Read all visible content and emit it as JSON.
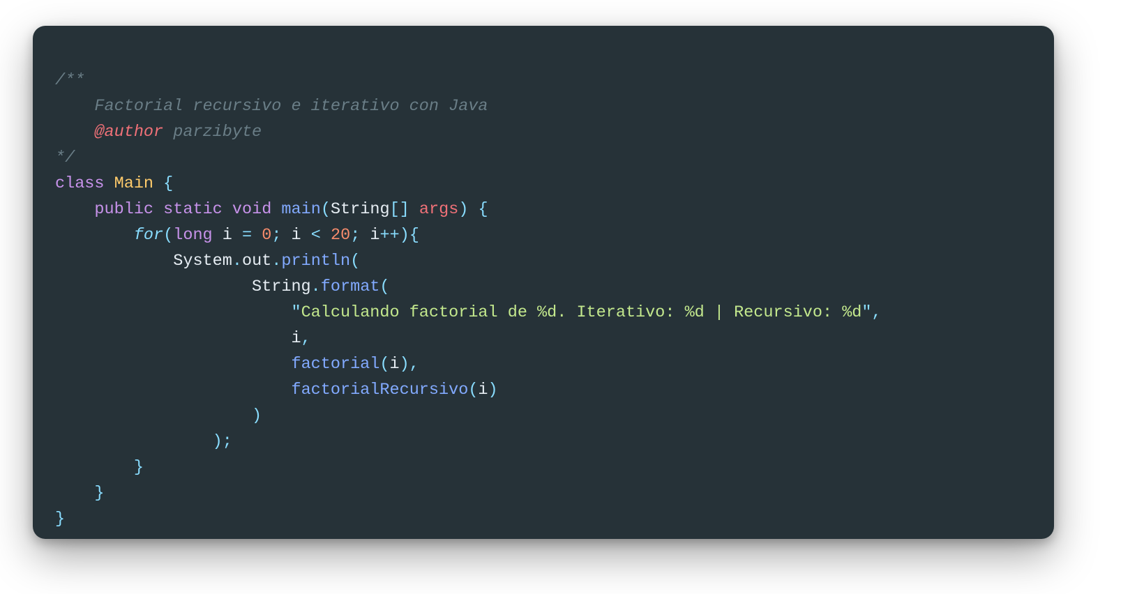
{
  "c": {
    "l1": "/**",
    "l2": "    Factorial recursivo e iterativo con Java",
    "l3_tag": "@author",
    "l3_txt": " parzibyte",
    "l4": "*/"
  },
  "kw": {
    "class": "class",
    "public": "public",
    "static": "static",
    "void": "void",
    "for": "for",
    "long": "long"
  },
  "sym": {
    "Main": "Main",
    "main": "main",
    "String": "String",
    "args": "args",
    "System": "System",
    "out": "out",
    "println": "println",
    "format": "format",
    "factorial": "factorial",
    "factorialRecursivo": "factorialRecursivo",
    "i": "i"
  },
  "lit": {
    "zero": "0",
    "twenty": "20",
    "fmt_q1": "\"",
    "fmt_body": "Calculando factorial de %d. Iterativo: %d | Recursivo: %d",
    "fmt_q2": "\""
  },
  "p": {
    "sp": " ",
    "ob": "{",
    "cb": "}",
    "op": "(",
    "cp": ")",
    "os": "[",
    "cs": "]",
    "sc": ";",
    "cm": ",",
    "dot": ".",
    "eq": "=",
    "lt": "<",
    "pp": "++"
  },
  "ind": {
    "i0": "",
    "i1": "    ",
    "i2": "        ",
    "i3": "            ",
    "i5": "                    ",
    "i6": "                        ",
    "i4s": "                "
  }
}
